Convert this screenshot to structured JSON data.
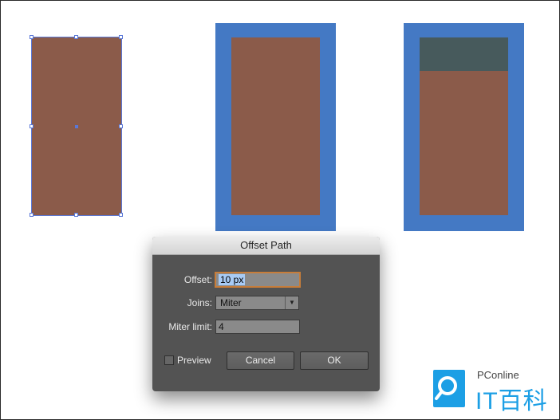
{
  "dialog": {
    "title": "Offset Path",
    "offset_label": "Offset:",
    "offset_value": "10 px",
    "joins_label": "Joins:",
    "joins_value": "Miter",
    "miter_label": "Miter limit:",
    "miter_value": "4",
    "preview_label": "Preview",
    "preview_checked": false,
    "cancel_label": "Cancel",
    "ok_label": "OK"
  },
  "logo": {
    "small_text": "PConline",
    "big_text": "IT百科"
  },
  "colors": {
    "fill": "#8b5b4a",
    "offset_fill": "#4479c4",
    "top_fill": "#475a5c",
    "selection": "#5a78d8",
    "logo": "#1c9fe5"
  }
}
